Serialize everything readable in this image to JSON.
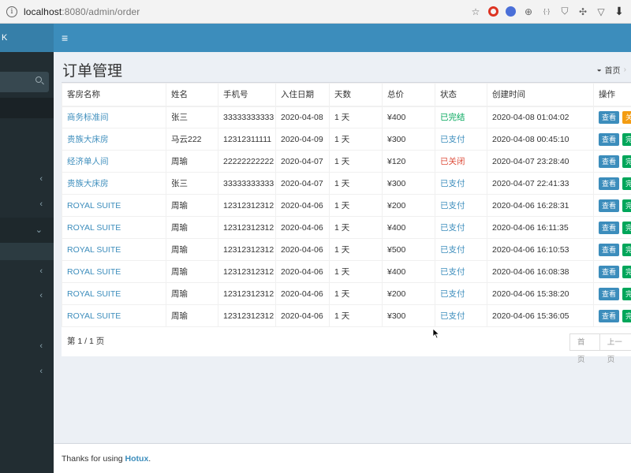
{
  "browser": {
    "url_host": "localhost",
    "url_path": ":8080/admin/order"
  },
  "sidebar": {
    "logo_text": "K"
  },
  "topbar": {
    "toggle_icon": "≡"
  },
  "page": {
    "title": "订单管理",
    "breadcrumb_home": "首页"
  },
  "table": {
    "headers": [
      "客房名称",
      "姓名",
      "手机号",
      "入住日期",
      "天数",
      "总价",
      "状态",
      "创建时间",
      "操作"
    ],
    "rows": [
      {
        "room": "商务标准间",
        "name": "张三",
        "phone": "33333333333",
        "checkin": "2020-04-08",
        "days": "1 天",
        "price": "¥400",
        "status": "已完结",
        "status_type": "done",
        "created": "2020-04-08 01:04:02",
        "btn1": "查看",
        "btn2": "关",
        "btn2_color": "orange"
      },
      {
        "room": "贵族大床房",
        "name": "马云222",
        "phone": "12312311111",
        "checkin": "2020-04-09",
        "days": "1 天",
        "price": "¥300",
        "status": "已支付",
        "status_type": "paid",
        "created": "2020-04-08 00:45:10",
        "btn1": "查看",
        "btn2": "完",
        "btn2_color": "green"
      },
      {
        "room": "经济单人间",
        "name": "周瑜",
        "phone": "22222222222",
        "checkin": "2020-04-07",
        "days": "1 天",
        "price": "¥120",
        "status": "已关闭",
        "status_type": "closed",
        "created": "2020-04-07 23:28:40",
        "btn1": "查看",
        "btn2": "完",
        "btn2_color": "green"
      },
      {
        "room": "贵族大床房",
        "name": "张三",
        "phone": "33333333333",
        "checkin": "2020-04-07",
        "days": "1 天",
        "price": "¥300",
        "status": "已支付",
        "status_type": "paid",
        "created": "2020-04-07 22:41:33",
        "btn1": "查看",
        "btn2": "完",
        "btn2_color": "green"
      },
      {
        "room": "ROYAL SUITE",
        "name": "周瑜",
        "phone": "12312312312",
        "checkin": "2020-04-06",
        "days": "1 天",
        "price": "¥200",
        "status": "已支付",
        "status_type": "paid",
        "created": "2020-04-06 16:28:31",
        "btn1": "查看",
        "btn2": "完",
        "btn2_color": "green"
      },
      {
        "room": "ROYAL SUITE",
        "name": "周瑜",
        "phone": "12312312312",
        "checkin": "2020-04-06",
        "days": "1 天",
        "price": "¥400",
        "status": "已支付",
        "status_type": "paid",
        "created": "2020-04-06 16:11:35",
        "btn1": "查看",
        "btn2": "完",
        "btn2_color": "green"
      },
      {
        "room": "ROYAL SUITE",
        "name": "周瑜",
        "phone": "12312312312",
        "checkin": "2020-04-06",
        "days": "1 天",
        "price": "¥500",
        "status": "已支付",
        "status_type": "paid",
        "created": "2020-04-06 16:10:53",
        "btn1": "查看",
        "btn2": "完",
        "btn2_color": "green"
      },
      {
        "room": "ROYAL SUITE",
        "name": "周瑜",
        "phone": "12312312312",
        "checkin": "2020-04-06",
        "days": "1 天",
        "price": "¥400",
        "status": "已支付",
        "status_type": "paid",
        "created": "2020-04-06 16:08:38",
        "btn1": "查看",
        "btn2": "完",
        "btn2_color": "green"
      },
      {
        "room": "ROYAL SUITE",
        "name": "周瑜",
        "phone": "12312312312",
        "checkin": "2020-04-06",
        "days": "1 天",
        "price": "¥200",
        "status": "已支付",
        "status_type": "paid",
        "created": "2020-04-06 15:38:20",
        "btn1": "查看",
        "btn2": "完",
        "btn2_color": "green"
      },
      {
        "room": "ROYAL SUITE",
        "name": "周瑜",
        "phone": "12312312312",
        "checkin": "2020-04-06",
        "days": "1 天",
        "price": "¥300",
        "status": "已支付",
        "status_type": "paid",
        "created": "2020-04-06 15:36:05",
        "btn1": "查看",
        "btn2": "完",
        "btn2_color": "green"
      }
    ]
  },
  "pagination": {
    "info": "第 1 / 1 页",
    "first": "首页",
    "prev": "上一页"
  },
  "footer": {
    "prefix": "Thanks for using ",
    "brand": "Hotux",
    "suffix": "."
  },
  "colors": {
    "primary": "#3c8dbc",
    "sidebar": "#222d32",
    "success": "#00a65a",
    "danger": "#dd4b39",
    "warning": "#f39c12"
  }
}
